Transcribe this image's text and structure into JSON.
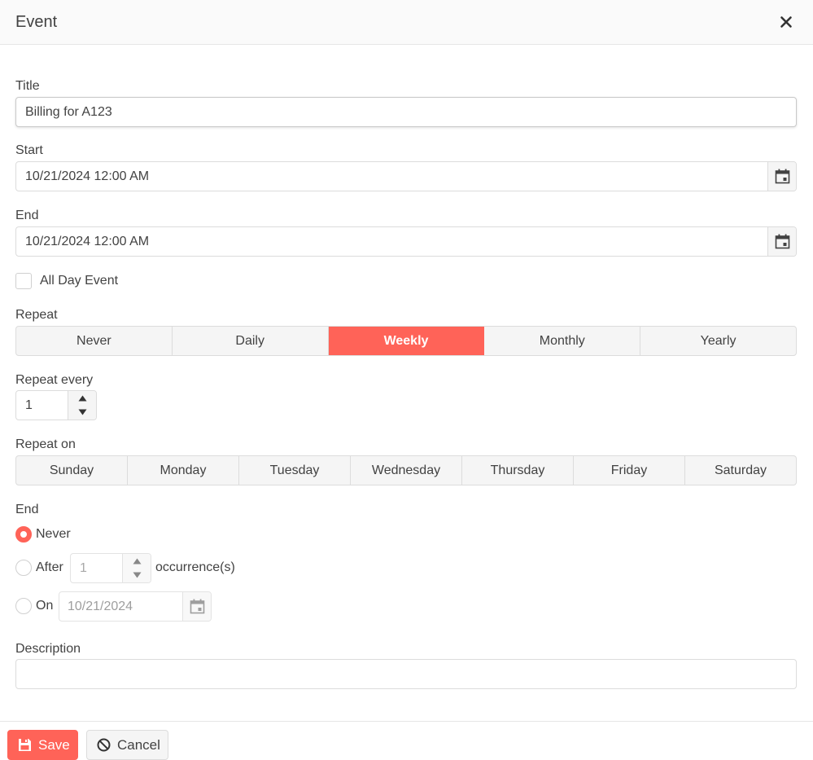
{
  "dialog": {
    "title": "Event"
  },
  "form": {
    "title_label": "Title",
    "title_value": "Billing for A123",
    "start_label": "Start",
    "start_value": "10/21/2024 12:00 AM",
    "end_label": "End",
    "end_value": "10/21/2024 12:00 AM",
    "all_day_label": "All Day Event",
    "all_day_checked": false,
    "repeat_label": "Repeat",
    "repeat_options": [
      "Never",
      "Daily",
      "Weekly",
      "Monthly",
      "Yearly"
    ],
    "repeat_selected": "Weekly",
    "repeat_every_label": "Repeat every",
    "repeat_every_value": "1",
    "repeat_on_label": "Repeat on",
    "days": [
      "Sunday",
      "Monday",
      "Tuesday",
      "Wednesday",
      "Thursday",
      "Friday",
      "Saturday"
    ],
    "end_section_label": "End",
    "end_never_label": "Never",
    "end_after_label": "After",
    "end_after_value": "1",
    "end_after_suffix": "occurrence(s)",
    "end_on_label": "On",
    "end_on_value": "10/21/2024",
    "end_selected": "Never",
    "description_label": "Description",
    "description_value": ""
  },
  "footer": {
    "save_label": "Save",
    "cancel_label": "Cancel"
  },
  "colors": {
    "accent": "#ff6358",
    "text": "#424242",
    "border": "#dcdcdc"
  }
}
